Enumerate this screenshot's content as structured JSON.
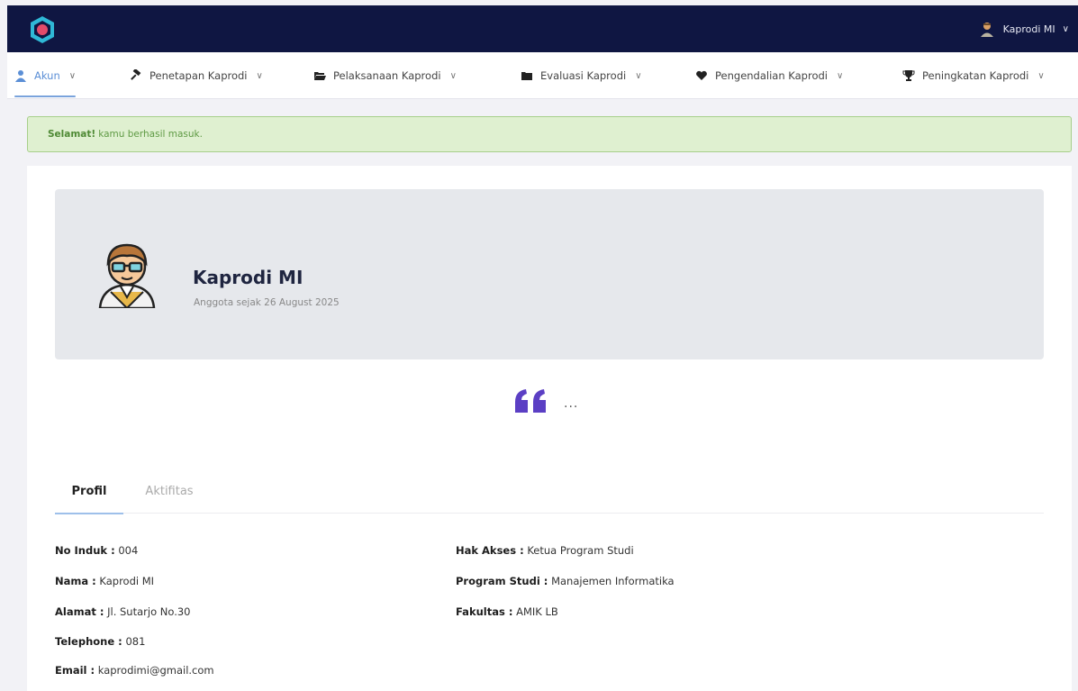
{
  "topbar": {
    "user_name": "Kaprodi MI",
    "chevron": "∨"
  },
  "nav": {
    "items": [
      {
        "label": "Akun",
        "icon": "user-icon"
      },
      {
        "label": "Penetapan Kaprodi",
        "icon": "gavel-icon"
      },
      {
        "label": "Pelaksanaan Kaprodi",
        "icon": "folder-open-icon"
      },
      {
        "label": "Evaluasi Kaprodi",
        "icon": "folder-icon"
      },
      {
        "label": "Pengendalian Kaprodi",
        "icon": "heart-icon"
      },
      {
        "label": "Peningkatan Kaprodi",
        "icon": "trophy-icon"
      }
    ]
  },
  "alert": {
    "strong": "Selamat!",
    "text": "kamu berhasil masuk."
  },
  "profile": {
    "name": "Kaprodi MI",
    "since": "Anggota sejak 26 August 2025",
    "quote": "..."
  },
  "tabs": {
    "profil": "Profil",
    "aktifitas": "Aktifitas"
  },
  "details": {
    "no_induk": {
      "label": "No Induk :",
      "value": "004"
    },
    "nama": {
      "label": "Nama :",
      "value": "Kaprodi MI"
    },
    "alamat": {
      "label": "Alamat :",
      "value": "Jl. Sutarjo No.30"
    },
    "telephone": {
      "label": "Telephone :",
      "value": "081"
    },
    "email": {
      "label": "Email :",
      "value": "kaprodimi@gmail.com"
    },
    "hak_akses": {
      "label": "Hak Akses :",
      "value": "Ketua Program Studi"
    },
    "program_studi": {
      "label": "Program Studi :",
      "value": "Manajemen Informatika"
    },
    "fakultas": {
      "label": "Fakultas :",
      "value": "AMIK LB"
    }
  },
  "colors": {
    "topbar": "#0f1642",
    "accent": "#5b8fd6",
    "quote": "#5b3fc4",
    "alert_bg": "#dff0d0"
  }
}
